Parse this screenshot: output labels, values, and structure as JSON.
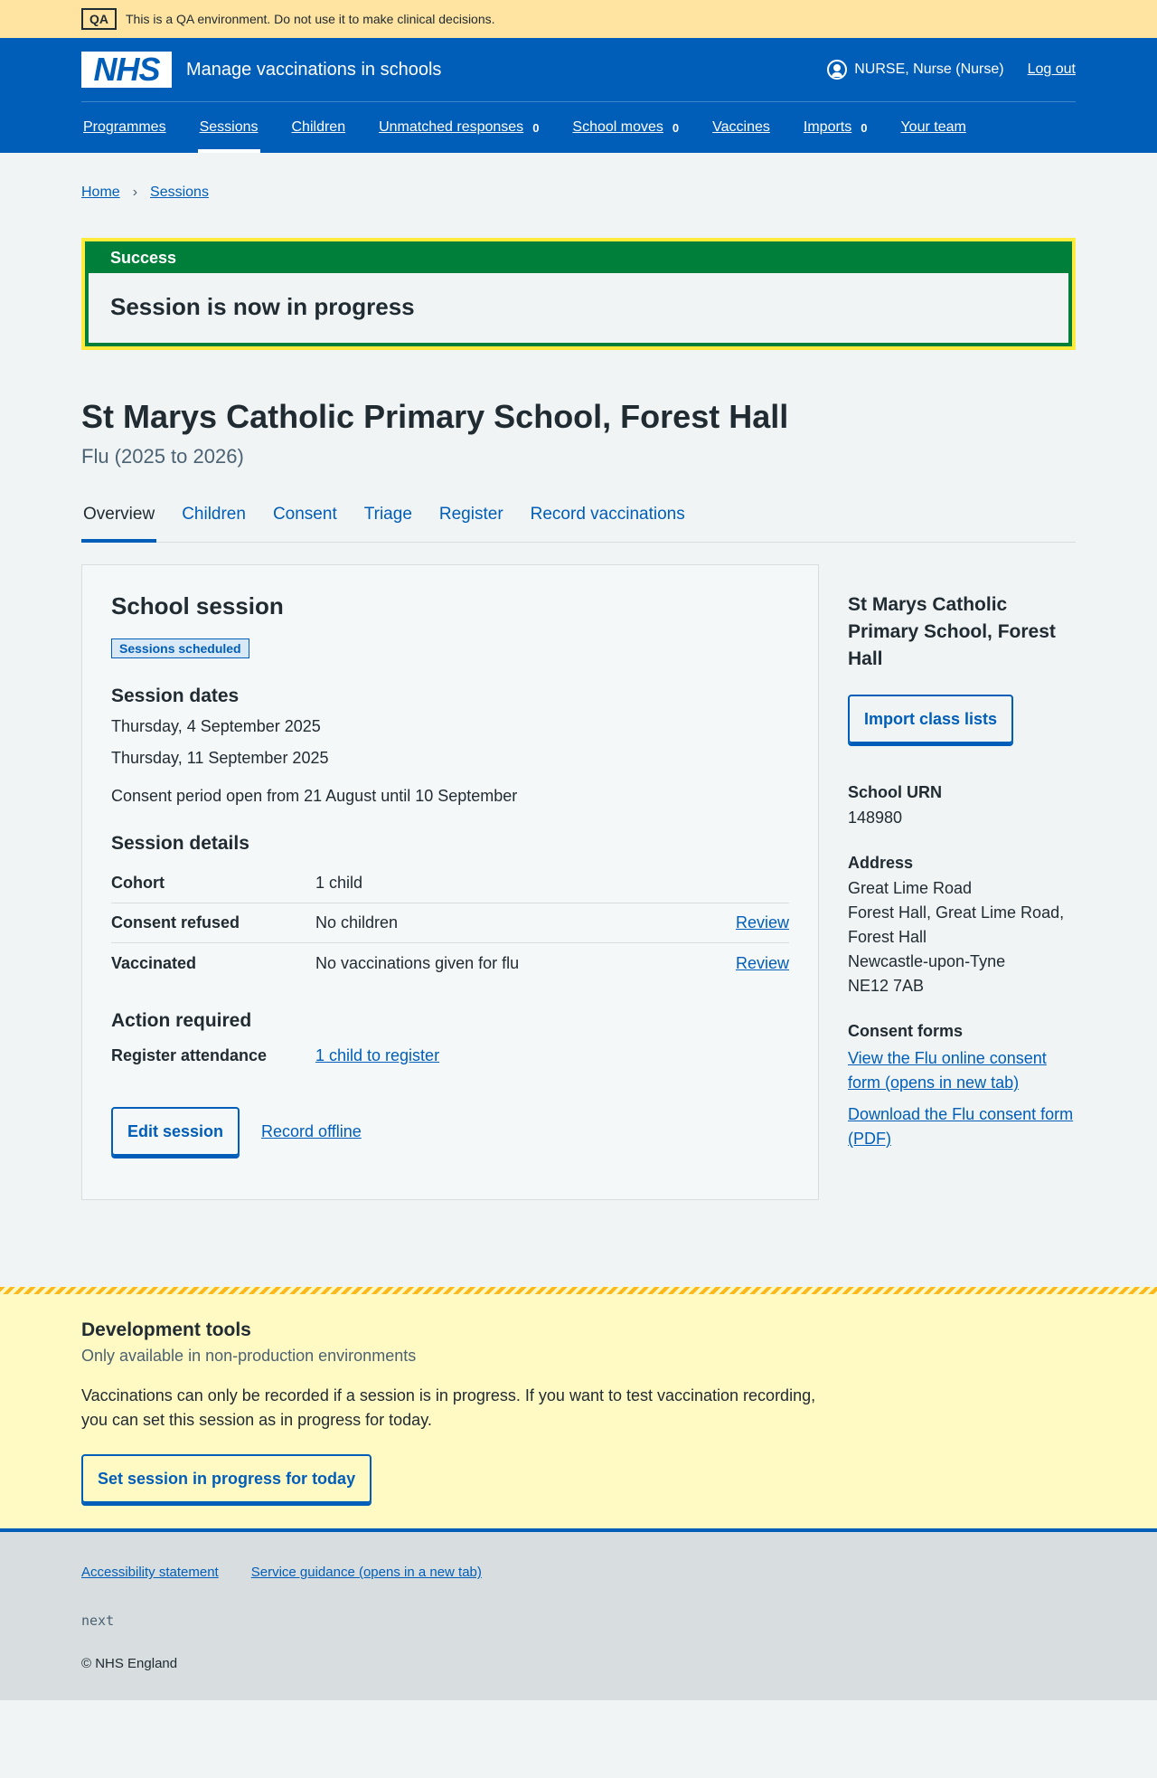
{
  "qa_banner": {
    "tag": "QA",
    "text": "This is a QA environment. Do not use it to make clinical decisions."
  },
  "header": {
    "logo": "NHS",
    "service_name": "Manage vaccinations in schools",
    "user": "NURSE, Nurse (Nurse)",
    "logout": "Log out"
  },
  "nav": [
    {
      "label": "Programmes",
      "count": ""
    },
    {
      "label": "Sessions",
      "count": ""
    },
    {
      "label": "Children",
      "count": ""
    },
    {
      "label": "Unmatched responses",
      "count": "0"
    },
    {
      "label": "School moves",
      "count": "0"
    },
    {
      "label": "Vaccines",
      "count": ""
    },
    {
      "label": "Imports",
      "count": "0"
    },
    {
      "label": "Your team",
      "count": ""
    }
  ],
  "breadcrumb": {
    "home": "Home",
    "sessions": "Sessions"
  },
  "success": {
    "title": "Success",
    "message": "Session is now in progress"
  },
  "page": {
    "title": "St Marys Catholic Primary School, Forest Hall",
    "caption": "Flu (2025 to 2026)"
  },
  "tabs": [
    "Overview",
    "Children",
    "Consent",
    "Triage",
    "Register",
    "Record vaccinations"
  ],
  "card": {
    "title": "School session",
    "status_tag": "Sessions scheduled",
    "dates_heading": "Session dates",
    "dates": [
      "Thursday, 4 September 2025",
      "Thursday, 11 September 2025"
    ],
    "consent_period": "Consent period open from 21 August until 10 September",
    "details_heading": "Session details",
    "details": [
      {
        "key": "Cohort",
        "value": "1 child",
        "action": ""
      },
      {
        "key": "Consent refused",
        "value": "No children",
        "action": "Review"
      },
      {
        "key": "Vaccinated",
        "value": "No vaccinations given for flu",
        "action": "Review"
      }
    ],
    "action_heading": "Action required",
    "action_key": "Register attendance",
    "action_link": "1 child to register",
    "edit_button": "Edit session",
    "offline_link": "Record offline"
  },
  "sidebar": {
    "school_name": "St Marys Catholic Primary School, Forest Hall",
    "import_button": "Import class lists",
    "urn_label": "School URN",
    "urn": "148980",
    "address_label": "Address",
    "address": [
      "Great Lime Road",
      "Forest Hall, Great Lime Road, Forest Hall",
      "Newcastle-upon-Tyne",
      "NE12 7AB"
    ],
    "consent_forms_label": "Consent forms",
    "consent_link_online": "View the Flu online consent form (opens in new tab)",
    "consent_link_pdf": "Download the Flu consent form (PDF)"
  },
  "dev_tools": {
    "title": "Development tools",
    "subtitle": "Only available in non-production environments",
    "description": "Vaccinations can only be recorded if a session is in progress. If you want to test vaccination recording, you can set this session as in progress for today.",
    "button": "Set session in progress for today"
  },
  "footer": {
    "accessibility": "Accessibility statement",
    "guidance": "Service guidance (opens in a new tab)",
    "version": "next",
    "copyright": "© NHS England"
  }
}
